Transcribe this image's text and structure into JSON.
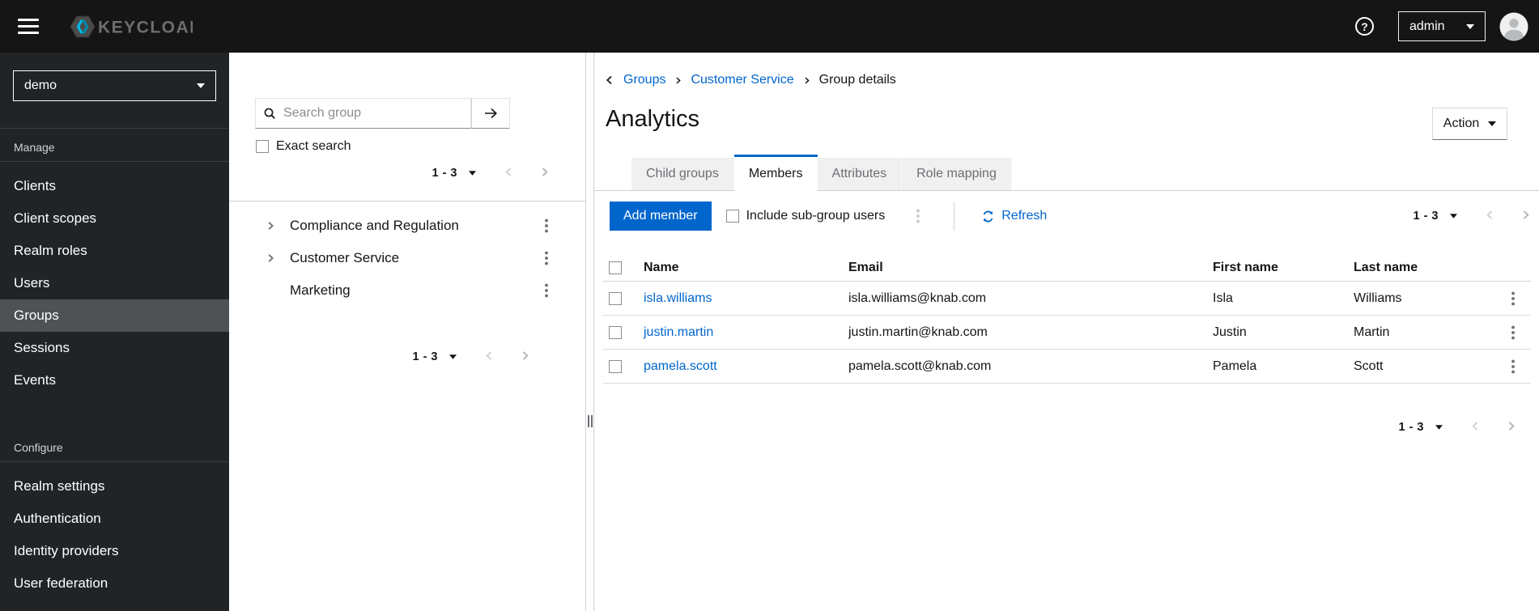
{
  "header": {
    "brand_text": "KEYCLOAK",
    "help_label": "?",
    "user_menu": "admin"
  },
  "sidebar": {
    "realm_selector": "demo",
    "sections": [
      {
        "label": "Manage",
        "items": [
          {
            "label": "Clients",
            "active": false
          },
          {
            "label": "Client scopes",
            "active": false
          },
          {
            "label": "Realm roles",
            "active": false
          },
          {
            "label": "Users",
            "active": false
          },
          {
            "label": "Groups",
            "active": true
          },
          {
            "label": "Sessions",
            "active": false
          },
          {
            "label": "Events",
            "active": false
          }
        ]
      },
      {
        "label": "Configure",
        "items": [
          {
            "label": "Realm settings",
            "active": false
          },
          {
            "label": "Authentication",
            "active": false
          },
          {
            "label": "Identity providers",
            "active": false
          },
          {
            "label": "User federation",
            "active": false
          }
        ]
      }
    ]
  },
  "group_tree": {
    "search": {
      "placeholder": "Search group",
      "value": ""
    },
    "exact_search_label": "Exact search",
    "pagination_top": {
      "range": "1 - 3"
    },
    "items": [
      {
        "name": "Compliance and Regulation",
        "expandable": true
      },
      {
        "name": "Customer Service",
        "expandable": true
      },
      {
        "name": "Marketing",
        "expandable": false
      }
    ],
    "pagination_bottom": {
      "range": "1 - 3"
    }
  },
  "main": {
    "breadcrumb": {
      "items": [
        "Groups",
        "Customer Service",
        "Group details"
      ]
    },
    "page_title": "Analytics",
    "action_button": "Action",
    "tabs": [
      {
        "label": "Child groups",
        "active": false
      },
      {
        "label": "Members",
        "active": true
      },
      {
        "label": "Attributes",
        "active": false
      },
      {
        "label": "Role mapping",
        "active": false
      }
    ],
    "toolbar": {
      "add_member": "Add member",
      "include_subgroups": "Include sub-group users",
      "refresh": "Refresh",
      "pagination": {
        "range": "1 - 3"
      }
    },
    "members_table": {
      "columns": [
        "Name",
        "Email",
        "First name",
        "Last name"
      ],
      "rows": [
        {
          "name": "isla.williams",
          "email": "isla.williams@knab.com",
          "first_name": "Isla",
          "last_name": "Williams"
        },
        {
          "name": "justin.martin",
          "email": "justin.martin@knab.com",
          "first_name": "Justin",
          "last_name": "Martin"
        },
        {
          "name": "pamela.scott",
          "email": "pamela.scott@knab.com",
          "first_name": "Pamela",
          "last_name": "Scott"
        }
      ]
    },
    "pagination_bottom": {
      "range": "1 - 3"
    }
  },
  "colors": {
    "primary_blue": "#0066cc",
    "header_bg": "#151515",
    "sidebar_bg": "#212427",
    "sidebar_active_bg": "#4f5255",
    "tab_inactive_bg": "#f0f0f0",
    "border": "#d2d2d2",
    "text_dark": "#151515",
    "text_muted": "#6a6e73",
    "logo_cyan": "#00b9e4"
  }
}
